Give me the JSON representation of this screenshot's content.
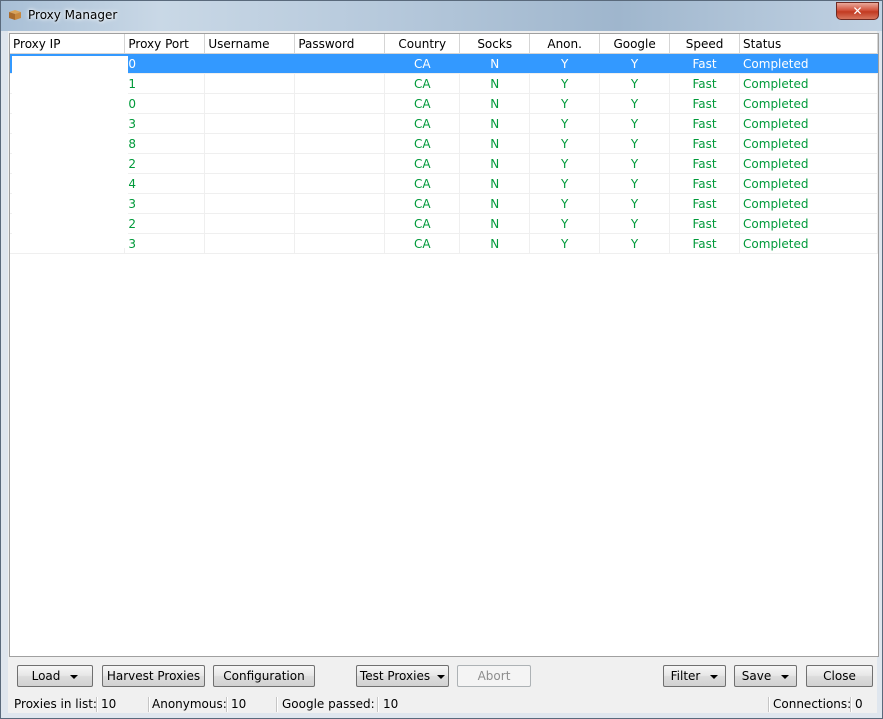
{
  "window": {
    "title": "Proxy Manager",
    "close_glyph": "✕"
  },
  "grid": {
    "columns": [
      "Proxy IP",
      "Proxy Port",
      "Username",
      "Password",
      "Country",
      "Socks",
      "Anon.",
      "Google",
      "Speed",
      "Status"
    ],
    "rows": [
      {
        "ip": "",
        "port": "0",
        "user": "",
        "pass": "",
        "country": "CA",
        "socks": "N",
        "anon": "Y",
        "google": "Y",
        "speed": "Fast",
        "status": "Completed"
      },
      {
        "ip": "",
        "port": "1",
        "user": "",
        "pass": "",
        "country": "CA",
        "socks": "N",
        "anon": "Y",
        "google": "Y",
        "speed": "Fast",
        "status": "Completed"
      },
      {
        "ip": "",
        "port": "0",
        "user": "",
        "pass": "",
        "country": "CA",
        "socks": "N",
        "anon": "Y",
        "google": "Y",
        "speed": "Fast",
        "status": "Completed"
      },
      {
        "ip": "",
        "port": "3",
        "user": "",
        "pass": "",
        "country": "CA",
        "socks": "N",
        "anon": "Y",
        "google": "Y",
        "speed": "Fast",
        "status": "Completed"
      },
      {
        "ip": "",
        "port": "8",
        "user": "",
        "pass": "",
        "country": "CA",
        "socks": "N",
        "anon": "Y",
        "google": "Y",
        "speed": "Fast",
        "status": "Completed"
      },
      {
        "ip": "",
        "port": "2",
        "user": "",
        "pass": "",
        "country": "CA",
        "socks": "N",
        "anon": "Y",
        "google": "Y",
        "speed": "Fast",
        "status": "Completed"
      },
      {
        "ip": "",
        "port": "4",
        "user": "",
        "pass": "",
        "country": "CA",
        "socks": "N",
        "anon": "Y",
        "google": "Y",
        "speed": "Fast",
        "status": "Completed"
      },
      {
        "ip": "",
        "port": "3",
        "user": "",
        "pass": "",
        "country": "CA",
        "socks": "N",
        "anon": "Y",
        "google": "Y",
        "speed": "Fast",
        "status": "Completed"
      },
      {
        "ip": "",
        "port": "2",
        "user": "",
        "pass": "",
        "country": "CA",
        "socks": "N",
        "anon": "Y",
        "google": "Y",
        "speed": "Fast",
        "status": "Completed"
      },
      {
        "ip": "",
        "port": "3",
        "user": "",
        "pass": "",
        "country": "CA",
        "socks": "N",
        "anon": "Y",
        "google": "Y",
        "speed": "Fast",
        "status": "Completed"
      }
    ],
    "selected_row": 0
  },
  "buttons": {
    "load": "Load",
    "harvest": "Harvest Proxies",
    "configuration": "Configuration",
    "test": "Test Proxies",
    "abort": "Abort",
    "filter": "Filter",
    "save": "Save",
    "close": "Close"
  },
  "statusbar": {
    "proxies_label": "Proxies in list:",
    "proxies_value": "10",
    "anon_label": "Anonymous:",
    "anon_value": "10",
    "google_label": "Google passed:",
    "google_value": "10",
    "conn_label": "Connections:",
    "conn_value": "0"
  },
  "colors": {
    "selection": "#3399ff",
    "row_text": "#009a3a"
  },
  "icons": {
    "app": "box-icon",
    "close": "close-icon",
    "dropdown": "dropdown-arrow-icon"
  }
}
